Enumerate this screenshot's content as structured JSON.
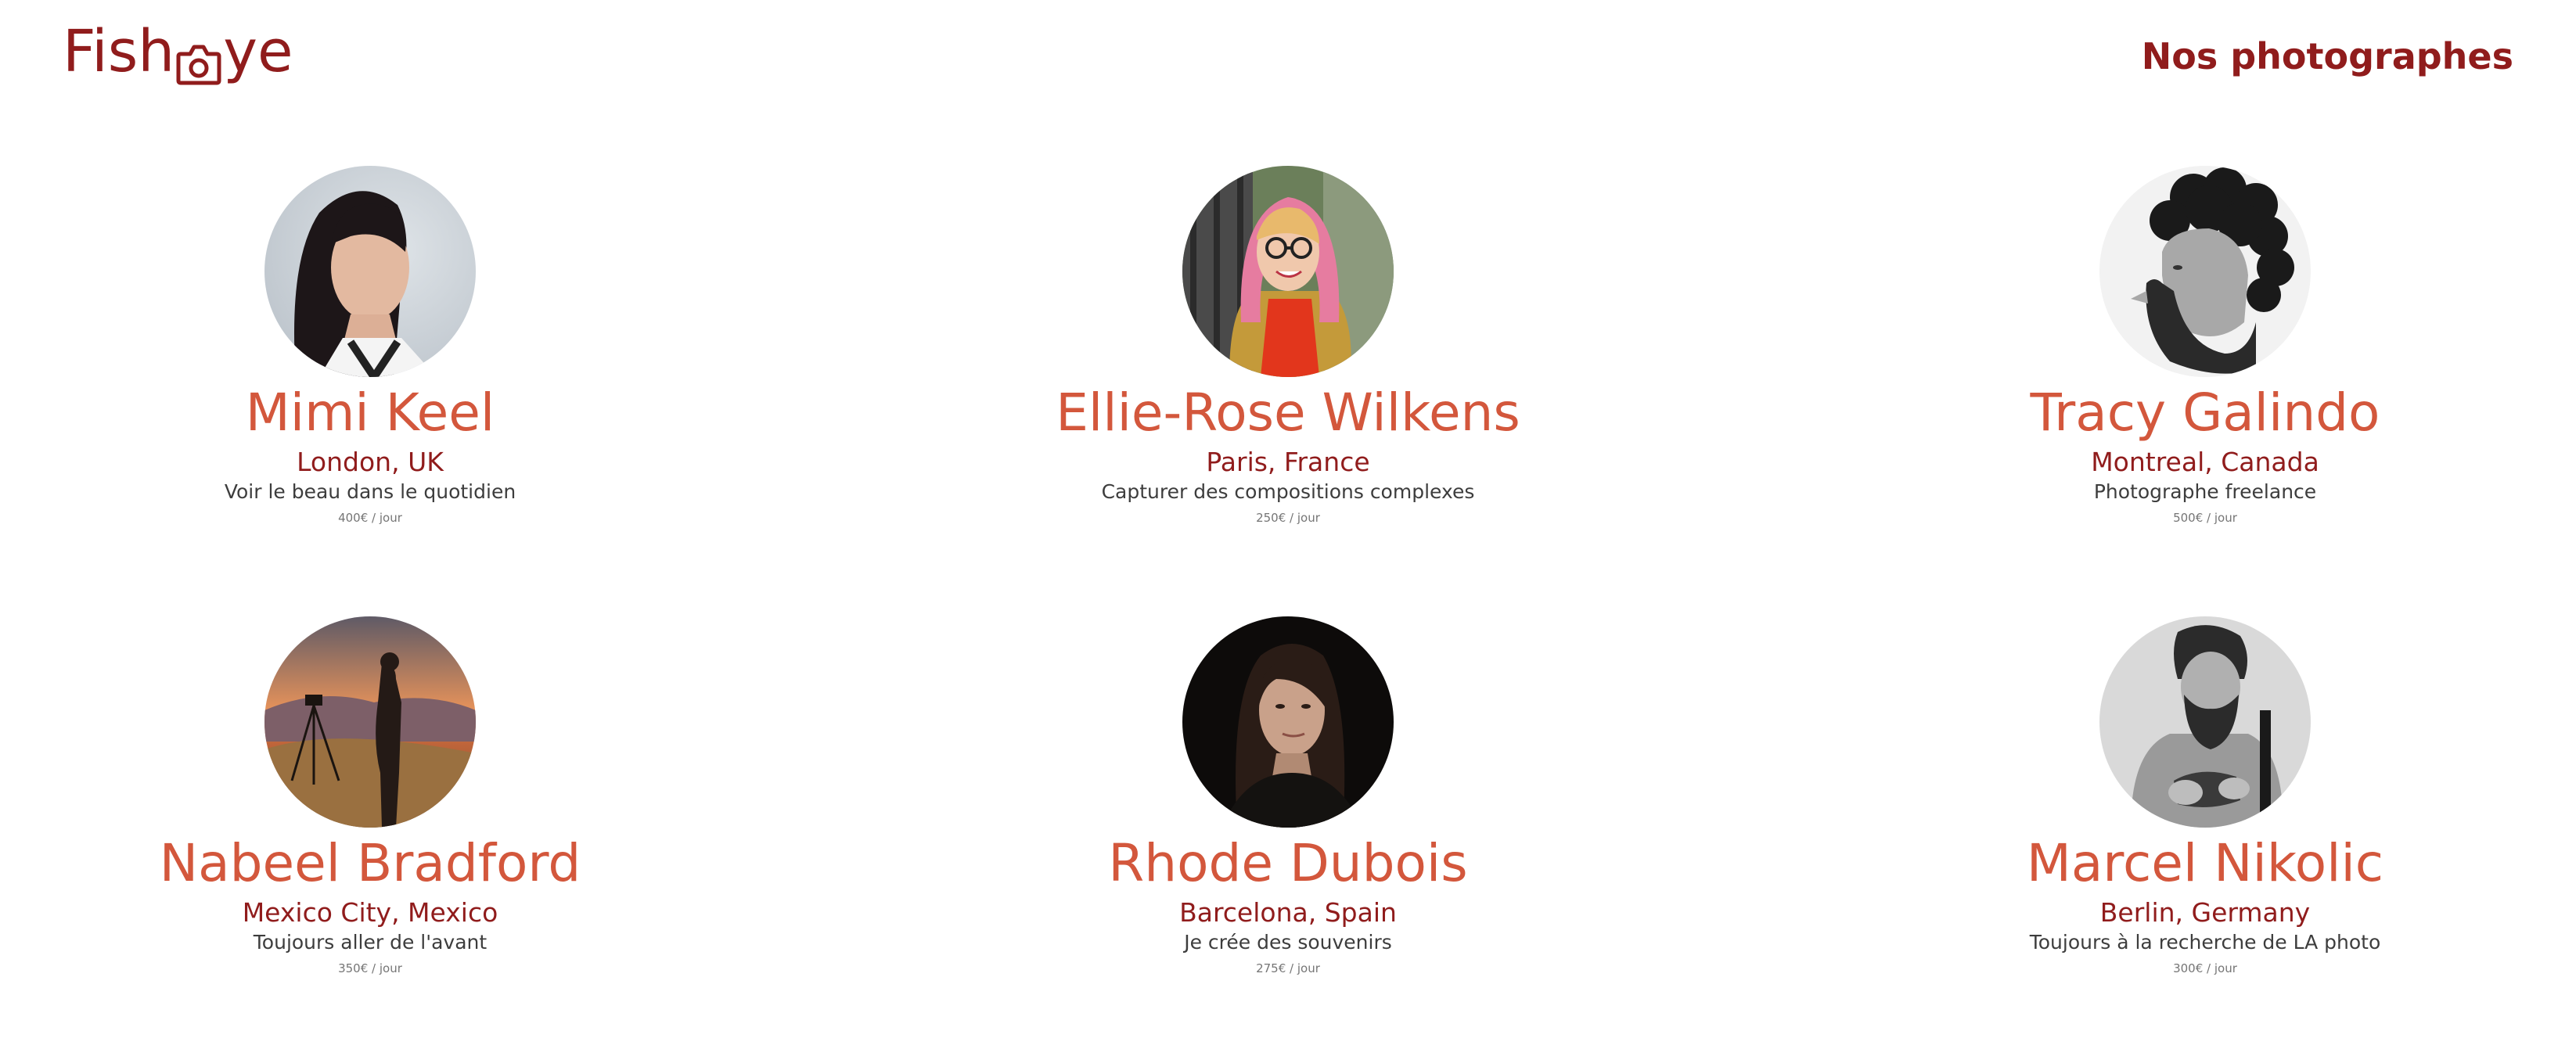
{
  "header": {
    "logo_text_left": "Fish",
    "logo_text_right": "ye",
    "logo_icon": "camera-icon",
    "title": "Nos photographes"
  },
  "colors": {
    "brand": "#901c1c",
    "name": "#d3573c",
    "tagline": "#3d3d3d",
    "price": "#757575"
  },
  "photographers": [
    {
      "name": "Mimi Keel",
      "location": "London, UK",
      "tagline": "Voir le beau dans le quotidien",
      "price": "400€ / jour"
    },
    {
      "name": "Ellie-Rose Wilkens",
      "location": "Paris, France",
      "tagline": "Capturer des compositions complexes",
      "price": "250€ / jour"
    },
    {
      "name": "Tracy Galindo",
      "location": "Montreal, Canada",
      "tagline": "Photographe freelance",
      "price": "500€ / jour"
    },
    {
      "name": "Nabeel Bradford",
      "location": "Mexico City, Mexico",
      "tagline": "Toujours aller de l'avant",
      "price": "350€ / jour"
    },
    {
      "name": "Rhode Dubois",
      "location": "Barcelona, Spain",
      "tagline": "Je crée des souvenirs",
      "price": "275€ / jour"
    },
    {
      "name": "Marcel Nikolic",
      "location": "Berlin, Germany",
      "tagline": "Toujours à la recherche de LA photo",
      "price": "300€ / jour"
    }
  ]
}
